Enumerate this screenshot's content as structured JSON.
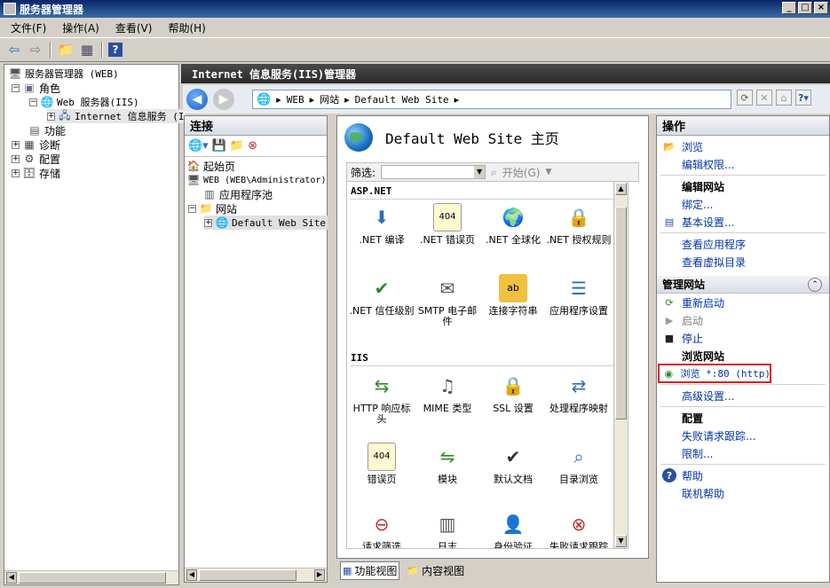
{
  "window": {
    "title": "服务器管理器"
  },
  "menu": [
    "文件(F)",
    "操作(A)",
    "查看(V)",
    "帮助(H)"
  ],
  "tree": {
    "root": "服务器管理器 (WEB)",
    "roles": "角色",
    "webserver": "Web 服务器(IIS)",
    "iis": "Internet 信息服务 (I",
    "features": "功能",
    "diagnostics": "诊断",
    "config": "配置",
    "storage": "存储"
  },
  "iis": {
    "header": "Internet 信息服务(IIS)管理器",
    "breadcrumb": [
      "WEB",
      "网站",
      "Default Web Site"
    ]
  },
  "connections": {
    "title": "连接",
    "items": [
      "起始页",
      "WEB (WEB\\Administrator)",
      "应用程序池",
      "网站",
      "Default Web Site"
    ]
  },
  "center": {
    "title": "Default Web Site 主页",
    "filter_label": "筛选:",
    "start_label": "开始(G)",
    "aspnet_section": "ASP.NET",
    "iis_section": "IIS",
    "aspnet_features": [
      ".NET 编译",
      ".NET 错误页",
      ".NET 全球化",
      ".NET 授权规则",
      ".NET 信任级别",
      "SMTP 电子邮件",
      "连接字符串",
      "应用程序设置"
    ],
    "iis_features": [
      "HTTP 响应标头",
      "MIME 类型",
      "SSL 设置",
      "处理程序映射",
      "错误页",
      "模块",
      "默认文档",
      "目录浏览",
      "请求筛选",
      "日志",
      "身份验证",
      "失败请求跟踪"
    ]
  },
  "view_tabs": {
    "features": "功能视图",
    "content": "内容视图"
  },
  "actions": {
    "title": "操作",
    "explore": "浏览",
    "edit_perms": "编辑权限...",
    "edit_site_title": "编辑网站",
    "bindings": "绑定...",
    "basic_settings": "基本设置...",
    "view_apps": "查看应用程序",
    "view_vdirs": "查看虚拟目录",
    "manage_title": "管理网站",
    "restart": "重新启动",
    "start": "启动",
    "stop": "停止",
    "browse_title": "浏览网站",
    "browse_80": "浏览 *:80 (http)",
    "advanced": "高级设置...",
    "config_title": "配置",
    "failed_tracing": "失败请求跟踪...",
    "limits": "限制...",
    "help": "帮助",
    "online_help": "联机帮助"
  },
  "colors": {
    "highlight": "#e02020",
    "link": "#0033aa",
    "title_bar": "#0a246a"
  }
}
